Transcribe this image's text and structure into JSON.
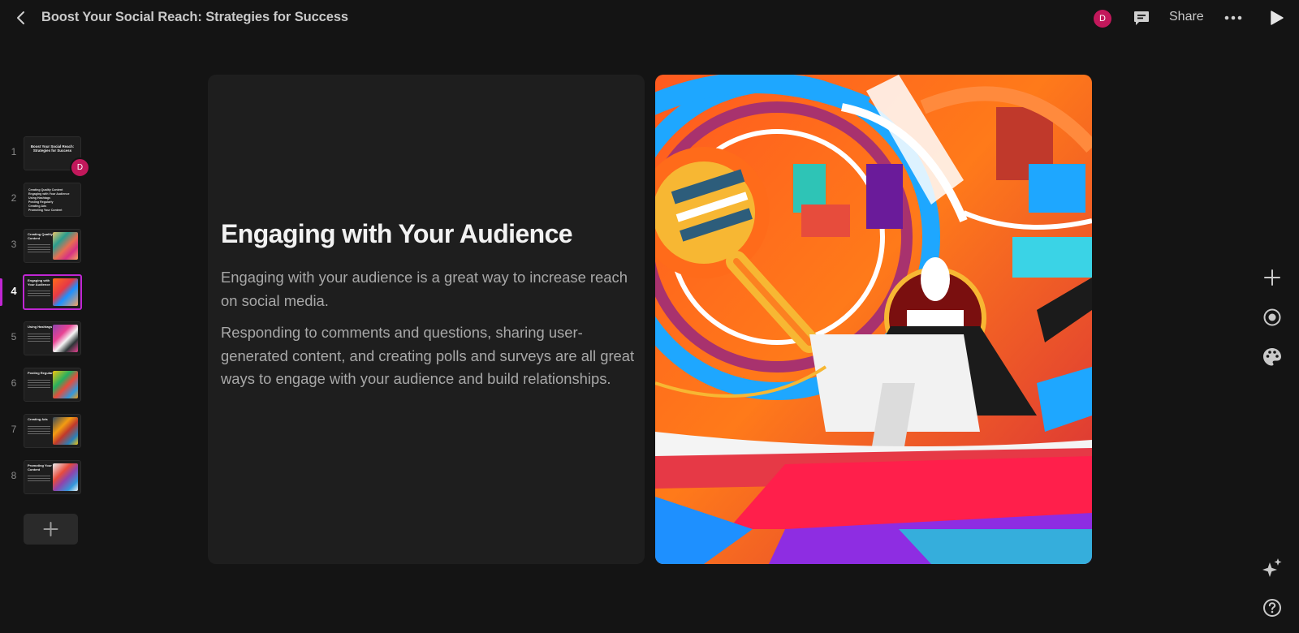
{
  "header": {
    "title": "Boost Your Social Reach: Strategies for Success",
    "avatar_initial": "D",
    "share_label": "Share"
  },
  "icons": {
    "back": "chevron-left-icon",
    "comment": "comment-icon",
    "more": "more-horizontal-icon",
    "play": "play-icon",
    "add": "plus-icon",
    "focus": "target-icon",
    "theme": "palette-icon",
    "ai": "sparkle-icon",
    "help": "help-icon"
  },
  "sidebar": {
    "slides": [
      {
        "number": "1",
        "title": "Boost Your Social Reach: Strategies for Success"
      },
      {
        "number": "2",
        "items": [
          "Creating Quality Content",
          "Engaging with Your Audience",
          "Using Hashtags",
          "Posting Regularly",
          "Creating Ads",
          "Promoting Your Content"
        ]
      },
      {
        "number": "3",
        "title": "Creating Quality Content"
      },
      {
        "number": "4",
        "title": "Engaging with Your Audience"
      },
      {
        "number": "5",
        "title": "Using Hashtags"
      },
      {
        "number": "6",
        "title": "Posting Regularly"
      },
      {
        "number": "7",
        "title": "Creating Ads"
      },
      {
        "number": "8",
        "title": "Promoting Your Content"
      }
    ],
    "active_slide": 4,
    "avatar_initial": "D"
  },
  "slide": {
    "title": "Engaging with Your Audience",
    "paragraphs": [
      "Engaging with your audience is a great way to increase reach on social media.",
      "Responding to comments and questions, sharing user-generated content, and creating polls and surveys are all great ways to engage with your audience and build relationships."
    ]
  },
  "colors": {
    "background": "#141414",
    "card": "#1e1e1e",
    "accent": "#c026d3",
    "avatar": "#c2185b"
  }
}
